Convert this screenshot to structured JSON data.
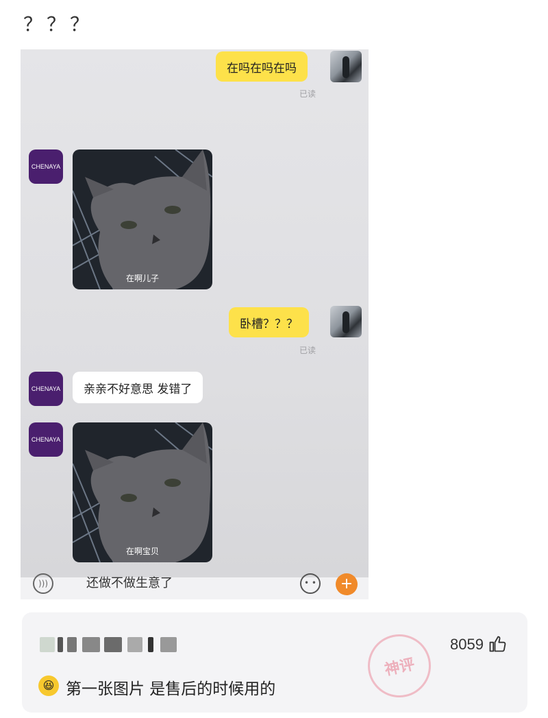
{
  "post": {
    "title": "？？？"
  },
  "chat": {
    "shop_avatar_label": "CHENAYA",
    "messages": [
      {
        "from": "self",
        "text": "在吗在吗在吗",
        "status": "已读"
      },
      {
        "from": "shop",
        "type": "sticker",
        "caption": "在啊儿子"
      },
      {
        "from": "self",
        "text": "卧槽？？？",
        "status": "已读"
      },
      {
        "from": "shop",
        "text": "亲亲不好意思 发错了"
      },
      {
        "from": "shop",
        "type": "sticker",
        "caption": "在啊宝贝"
      }
    ],
    "input": {
      "text": "还做不做生意了"
    },
    "icons": {
      "voice": "voice-icon",
      "emoji": "emoji-icon",
      "plus": "plus-icon"
    }
  },
  "comment": {
    "likes": "8059",
    "text": "第一张图片  是售后的时候用的",
    "stamp_text": "神评",
    "icons": {
      "like": "thumbs-up-icon",
      "emoji": "laughing-emoji-icon"
    }
  }
}
